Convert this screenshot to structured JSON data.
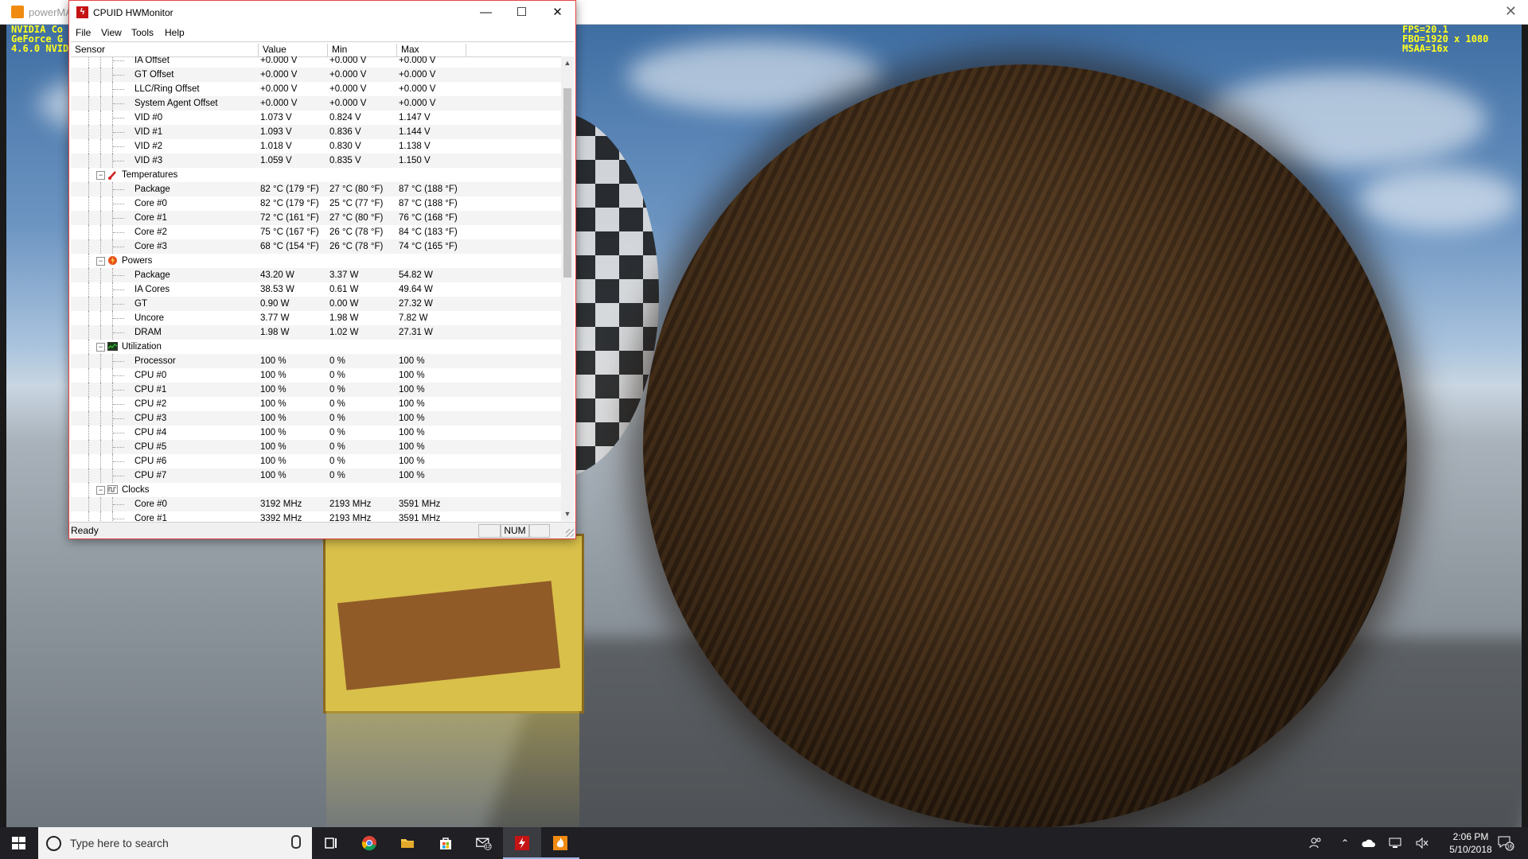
{
  "background_app": {
    "title": "powerMA",
    "osd_left": [
      "NVIDIA Co",
      "GeForce G",
      "4.6.0 NVID"
    ],
    "osd_right": [
      "FPS=20.1",
      "FBO=1920 x 1080",
      "MSAA=16x"
    ]
  },
  "hwmonitor": {
    "title": "CPUID HWMonitor",
    "menu": [
      "File",
      "View",
      "Tools",
      "Help"
    ],
    "columns": [
      "Sensor",
      "Value",
      "Min",
      "Max"
    ],
    "rows": [
      {
        "kind": "item",
        "sensor": "IA Offset",
        "value": "+0.000 V",
        "min": "+0.000 V",
        "max": "+0.000 V"
      },
      {
        "kind": "item",
        "sensor": "GT Offset",
        "value": "+0.000 V",
        "min": "+0.000 V",
        "max": "+0.000 V"
      },
      {
        "kind": "item",
        "sensor": "LLC/Ring Offset",
        "value": "+0.000 V",
        "min": "+0.000 V",
        "max": "+0.000 V"
      },
      {
        "kind": "item",
        "sensor": "System Agent Offset",
        "value": "+0.000 V",
        "min": "+0.000 V",
        "max": "+0.000 V"
      },
      {
        "kind": "item",
        "sensor": "VID #0",
        "value": "1.073 V",
        "min": "0.824 V",
        "max": "1.147 V"
      },
      {
        "kind": "item",
        "sensor": "VID #1",
        "value": "1.093 V",
        "min": "0.836 V",
        "max": "1.144 V"
      },
      {
        "kind": "item",
        "sensor": "VID #2",
        "value": "1.018 V",
        "min": "0.830 V",
        "max": "1.138 V"
      },
      {
        "kind": "item",
        "sensor": "VID #3",
        "value": "1.059 V",
        "min": "0.835 V",
        "max": "1.150 V"
      },
      {
        "kind": "group",
        "sensor": "Temperatures",
        "icon": "thermometer-icon"
      },
      {
        "kind": "item",
        "sensor": "Package",
        "value": "82 °C  (179 °F)",
        "min": "27 °C  (80 °F)",
        "max": "87 °C  (188 °F)"
      },
      {
        "kind": "item",
        "sensor": "Core #0",
        "value": "82 °C  (179 °F)",
        "min": "25 °C  (77 °F)",
        "max": "87 °C  (188 °F)"
      },
      {
        "kind": "item",
        "sensor": "Core #1",
        "value": "72 °C  (161 °F)",
        "min": "27 °C  (80 °F)",
        "max": "76 °C  (168 °F)"
      },
      {
        "kind": "item",
        "sensor": "Core #2",
        "value": "75 °C  (167 °F)",
        "min": "26 °C  (78 °F)",
        "max": "84 °C  (183 °F)"
      },
      {
        "kind": "item",
        "sensor": "Core #3",
        "value": "68 °C  (154 °F)",
        "min": "26 °C  (78 °F)",
        "max": "74 °C  (165 °F)"
      },
      {
        "kind": "group",
        "sensor": "Powers",
        "icon": "power-icon"
      },
      {
        "kind": "item",
        "sensor": "Package",
        "value": "43.20 W",
        "min": "3.37 W",
        "max": "54.82 W"
      },
      {
        "kind": "item",
        "sensor": "IA Cores",
        "value": "38.53 W",
        "min": "0.61 W",
        "max": "49.64 W"
      },
      {
        "kind": "item",
        "sensor": "GT",
        "value": "0.90 W",
        "min": "0.00 W",
        "max": "27.32 W"
      },
      {
        "kind": "item",
        "sensor": "Uncore",
        "value": "3.77 W",
        "min": "1.98 W",
        "max": "7.82 W"
      },
      {
        "kind": "item",
        "sensor": "DRAM",
        "value": "1.98 W",
        "min": "1.02 W",
        "max": "27.31 W"
      },
      {
        "kind": "group",
        "sensor": "Utilization",
        "icon": "utilization-icon"
      },
      {
        "kind": "item",
        "sensor": "Processor",
        "value": "100 %",
        "min": "0 %",
        "max": "100 %"
      },
      {
        "kind": "item",
        "sensor": "CPU #0",
        "value": "100 %",
        "min": "0 %",
        "max": "100 %"
      },
      {
        "kind": "item",
        "sensor": "CPU #1",
        "value": "100 %",
        "min": "0 %",
        "max": "100 %"
      },
      {
        "kind": "item",
        "sensor": "CPU #2",
        "value": "100 %",
        "min": "0 %",
        "max": "100 %"
      },
      {
        "kind": "item",
        "sensor": "CPU #3",
        "value": "100 %",
        "min": "0 %",
        "max": "100 %"
      },
      {
        "kind": "item",
        "sensor": "CPU #4",
        "value": "100 %",
        "min": "0 %",
        "max": "100 %"
      },
      {
        "kind": "item",
        "sensor": "CPU #5",
        "value": "100 %",
        "min": "0 %",
        "max": "100 %"
      },
      {
        "kind": "item",
        "sensor": "CPU #6",
        "value": "100 %",
        "min": "0 %",
        "max": "100 %"
      },
      {
        "kind": "item",
        "sensor": "CPU #7",
        "value": "100 %",
        "min": "0 %",
        "max": "100 %"
      },
      {
        "kind": "group",
        "sensor": "Clocks",
        "icon": "clock-wave-icon"
      },
      {
        "kind": "item",
        "sensor": "Core #0",
        "value": "3192 MHz",
        "min": "2193 MHz",
        "max": "3591 MHz"
      },
      {
        "kind": "item",
        "sensor": "Core #1",
        "value": "3392 MHz",
        "min": "2193 MHz",
        "max": "3591 MHz"
      }
    ],
    "status": {
      "text": "Ready",
      "num": "NUM"
    }
  },
  "taskbar": {
    "search_placeholder": "Type here to search",
    "apps": [
      {
        "name": "task-view",
        "icon": "task-view-icon"
      },
      {
        "name": "chrome",
        "icon": "chrome-icon"
      },
      {
        "name": "file-explorer",
        "icon": "folder-icon"
      },
      {
        "name": "store",
        "icon": "store-icon"
      },
      {
        "name": "mail",
        "icon": "mail-icon",
        "badge": "12"
      },
      {
        "name": "hwmonitor",
        "icon": "hwmonitor-icon"
      },
      {
        "name": "powerma",
        "icon": "flame-icon"
      }
    ],
    "time": "2:06 PM",
    "date": "5/10/2018",
    "notifications_count": "16"
  }
}
